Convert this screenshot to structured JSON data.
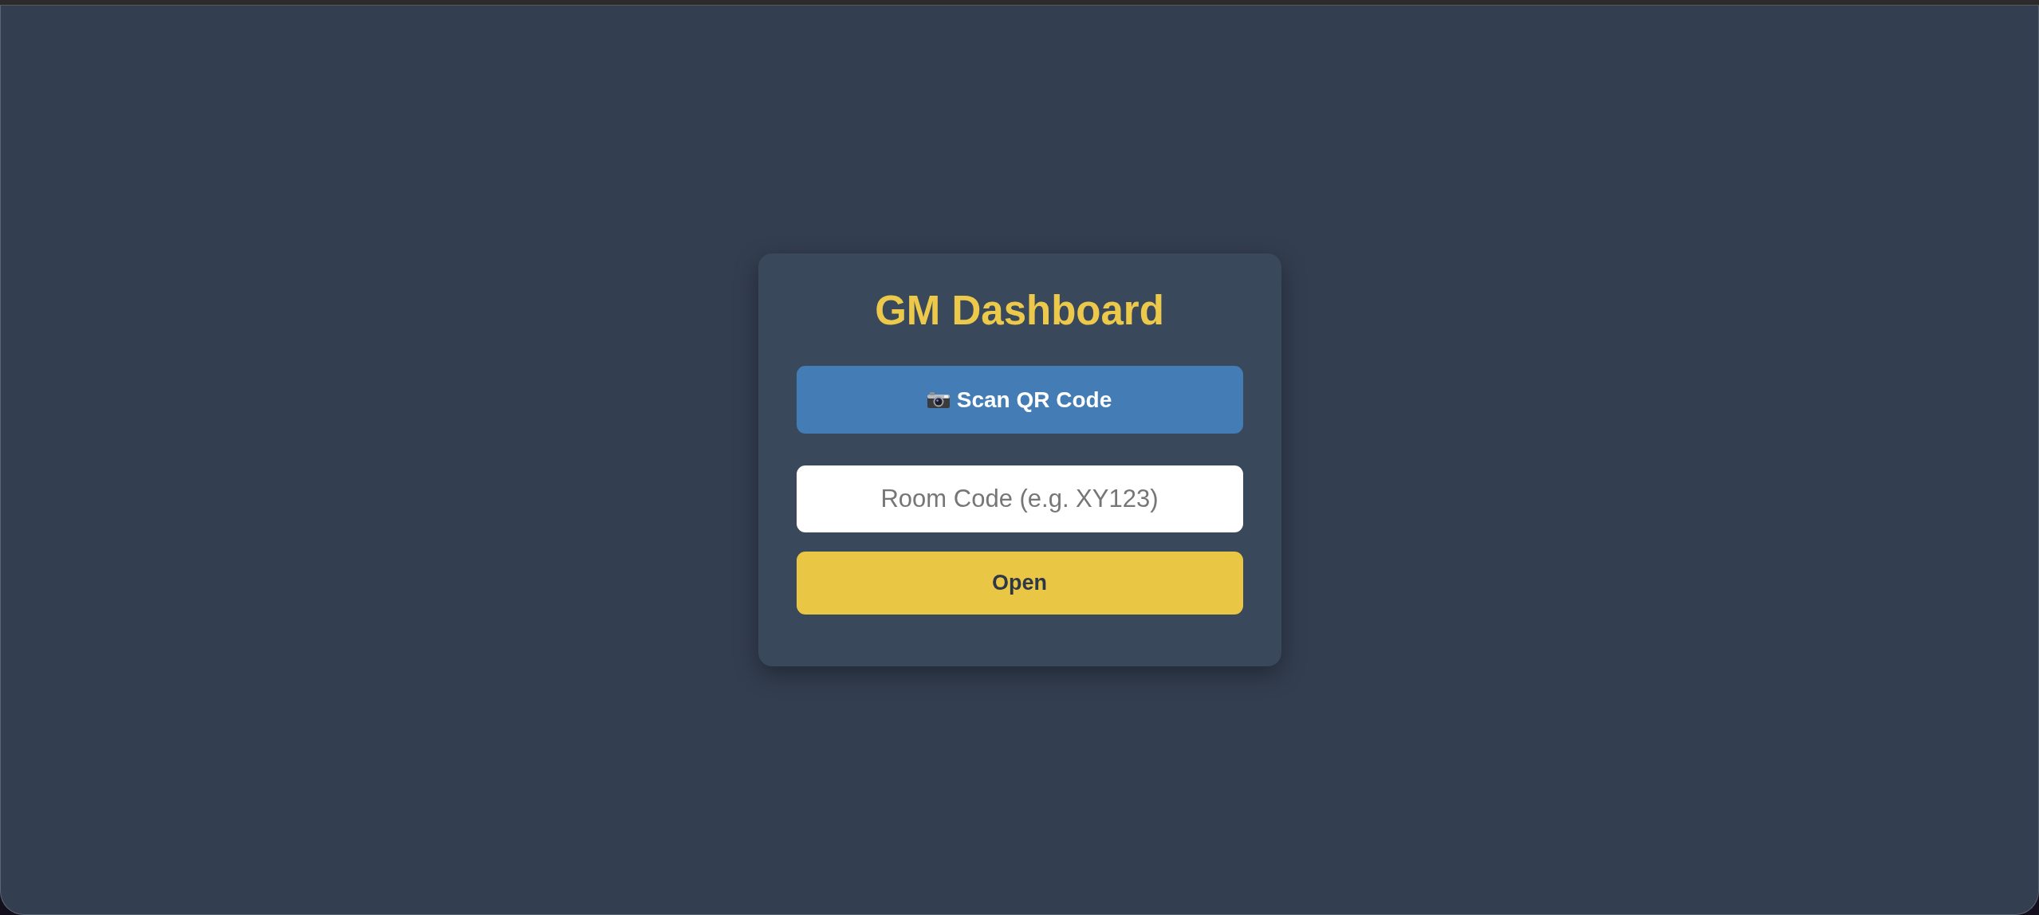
{
  "title": "GM Dashboard",
  "scan_button": {
    "label": "Scan QR Code"
  },
  "room_code_field": {
    "placeholder": "Room Code (e.g. XY123)"
  },
  "open_button": {
    "label": "Open"
  }
}
